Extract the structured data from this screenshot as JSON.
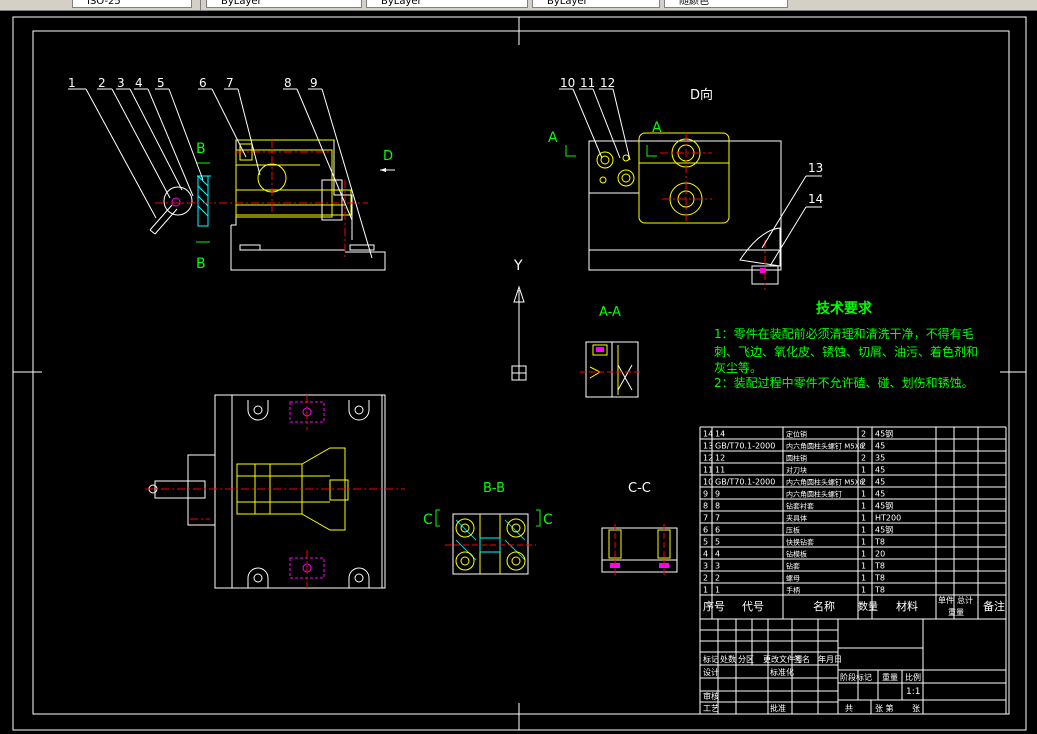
{
  "toolbar": {
    "style_field": "ISO-25",
    "layer_field": "ByLayer",
    "linetype_field": "ByLayer",
    "lineweight_field": "ByLayer",
    "color_field": "随颜色"
  },
  "drawing": {
    "balloons": [
      "1",
      "2",
      "3",
      "4",
      "5",
      "6",
      "7",
      "8",
      "9",
      "10",
      "11",
      "12",
      "13",
      "14"
    ],
    "view_d_arrow": "D",
    "view_d_title": "D向",
    "section_a_mark": "A",
    "section_b_mark": "B",
    "section_c_mark": "C",
    "section_aa_title": "A-A",
    "section_bb_title": "B-B",
    "section_cc_title": "C-C",
    "ucs_y": "Y"
  },
  "tech_requirements": {
    "title": "技术要求",
    "line1": "1：零件在装配前必须清理和清洗干净，不得有毛",
    "line2": "刺、飞边、氧化皮、锈蚀、切屑、油污、着色剂和",
    "line3": "灰尘等。",
    "line4": "2：装配过程中零件不允许磕、碰、划伤和锈蚀。"
  },
  "bom": {
    "rows": [
      {
        "seq": "14",
        "code": "14",
        "name": "定位销",
        "qty": "2",
        "material": "45钢"
      },
      {
        "seq": "13",
        "code": "GB/T70.1-2000",
        "name": "内六角圆柱头螺钉 M5X8",
        "qty": "2",
        "material": "45"
      },
      {
        "seq": "12",
        "code": "12",
        "name": "圆柱销",
        "qty": "2",
        "material": "35"
      },
      {
        "seq": "11",
        "code": "11",
        "name": "对刀块",
        "qty": "1",
        "material": "45"
      },
      {
        "seq": "10",
        "code": "GB/T70.1-2000",
        "name": "内六角圆柱头螺钉 M5X8",
        "qty": "2",
        "material": "45"
      },
      {
        "seq": "9",
        "code": "9",
        "name": "内六角圆柱头螺钉",
        "qty": "1",
        "material": "45"
      },
      {
        "seq": "8",
        "code": "8",
        "name": "钻套衬套",
        "qty": "1",
        "material": "45钢"
      },
      {
        "seq": "7",
        "code": "7",
        "name": "夹具体",
        "qty": "1",
        "material": "HT200"
      },
      {
        "seq": "6",
        "code": "6",
        "name": "压板",
        "qty": "1",
        "material": "45钢"
      },
      {
        "seq": "5",
        "code": "5",
        "name": "快换钻套",
        "qty": "1",
        "material": "T8"
      },
      {
        "seq": "4",
        "code": "4",
        "name": "钻模板",
        "qty": "1",
        "material": "20"
      },
      {
        "seq": "3",
        "code": "3",
        "name": "钻套",
        "qty": "1",
        "material": "T8"
      },
      {
        "seq": "2",
        "code": "2",
        "name": "螺母",
        "qty": "1",
        "material": "T8"
      },
      {
        "seq": "1",
        "code": "1",
        "name": "手柄",
        "qty": "1",
        "material": "T8"
      }
    ],
    "headers": {
      "seq": "序号",
      "code": "代号",
      "name": "名称",
      "qty": "数量",
      "material": "材料",
      "single": "单件",
      "total": "总计",
      "weight": "重量",
      "note": "备注"
    }
  },
  "title_block": {
    "mark": "标记",
    "count": "处数",
    "zone": "分区",
    "change_no": "更改文件号",
    "sign": "签名",
    "date": "年月日",
    "design": "设计",
    "standard": "标准化",
    "stage_mark": "阶段标记",
    "weight": "重量",
    "ratio": "比例",
    "scale": "1:1",
    "review": "审核",
    "process": "工艺",
    "approve": "批准",
    "sheets": "共",
    "sheet_no": "张 第",
    "sheet_unit": "张"
  },
  "colors": {
    "background": "#000000",
    "outline": "#ffffff",
    "part": "#ffff00",
    "centerline": "#ff0000",
    "section": "#00ffff",
    "dimension": "#00ff00",
    "hidden": "#ff00ff",
    "balloon": "#ffffff"
  }
}
